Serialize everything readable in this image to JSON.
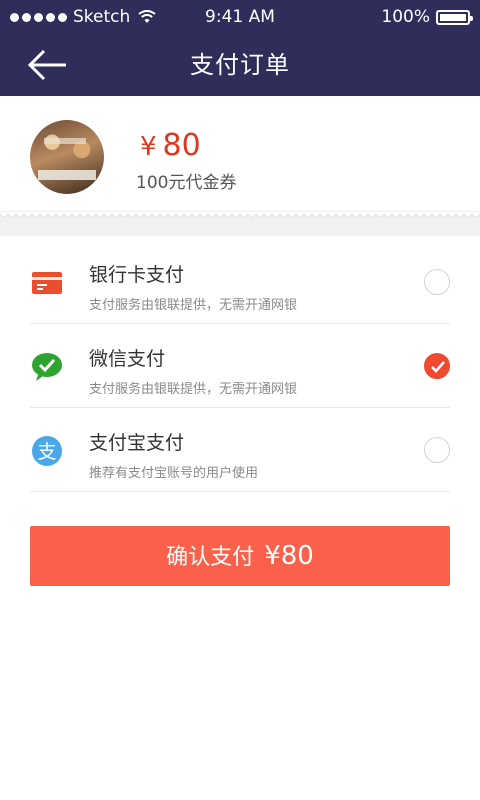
{
  "status_bar": {
    "carrier": "Sketch",
    "time": "9:41 AM",
    "battery": "100%"
  },
  "nav": {
    "title": "支付订单"
  },
  "order": {
    "currency": "¥",
    "amount": "80",
    "item": "100元代金券"
  },
  "methods": [
    {
      "name": "银行卡支付",
      "desc": "支付服务由银联提供，无需开通网银",
      "selected": false,
      "icon": "bank-card-icon"
    },
    {
      "name": "微信支付",
      "desc": "支付服务由银联提供，无需开通网银",
      "selected": true,
      "icon": "wechat-icon"
    },
    {
      "name": "支付宝支付",
      "desc": "推荐有支付宝账号的用户使用",
      "selected": false,
      "icon": "alipay-icon"
    }
  ],
  "confirm": {
    "label": "确认支付",
    "amount": "¥80"
  },
  "colors": {
    "nav_bg": "#2f2e5a",
    "accent": "#ef4a2f",
    "button": "#fb614a",
    "wechat": "#2fa32f",
    "alipay": "#4aa8e8"
  }
}
